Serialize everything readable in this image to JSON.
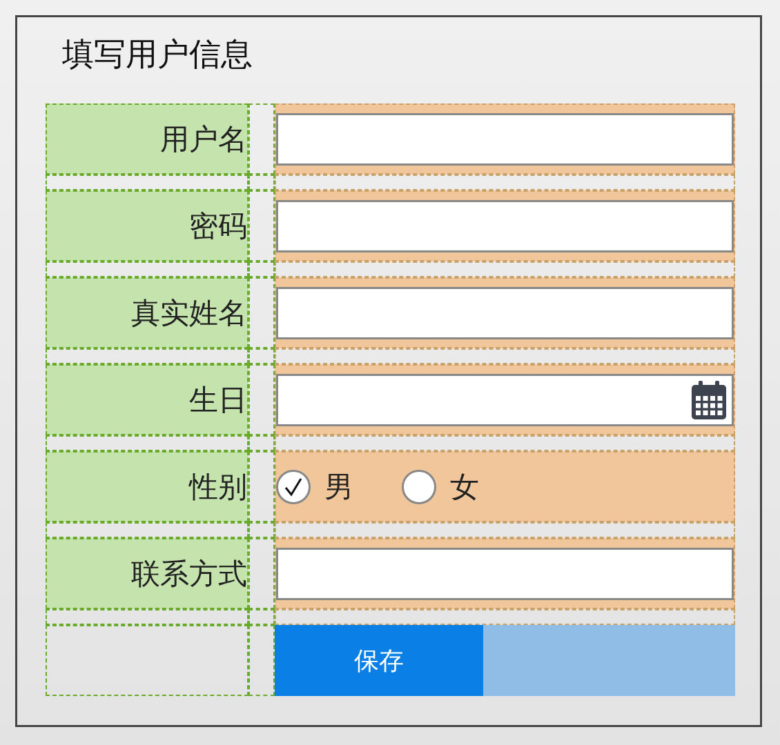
{
  "title": "填写用户信息",
  "fields": [
    {
      "label": "用户名",
      "kind": "text"
    },
    {
      "label": "密码",
      "kind": "text"
    },
    {
      "label": "真实姓名",
      "kind": "text"
    },
    {
      "label": "生日",
      "kind": "date"
    },
    {
      "label": "性别",
      "kind": "radio",
      "options": [
        {
          "label": "男",
          "selected": true
        },
        {
          "label": "女",
          "selected": false
        }
      ]
    },
    {
      "label": "联系方式",
      "kind": "text"
    }
  ],
  "button": "保存"
}
